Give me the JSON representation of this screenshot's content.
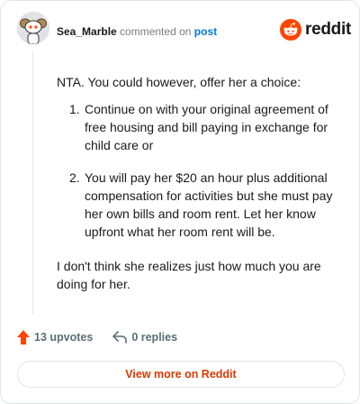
{
  "header": {
    "username": "Sea_Marble",
    "action_text": "commented on",
    "post_link": "post"
  },
  "brand": {
    "wordmark": "reddit",
    "color": "#ff4500"
  },
  "comment": {
    "intro": "NTA. You could however, offer her a choice:",
    "items": [
      {
        "number": "1.",
        "text": "Continue on with your original agreement of free housing and bill paying in exchange for child care or"
      },
      {
        "number": "2.",
        "text": "You will pay her $20 an hour plus additional compensation for activities but she must pay her own bills and room rent. Let her know upfront what her room rent will be."
      }
    ],
    "closing": "I don't think she realizes just how much you are doing for her."
  },
  "footer": {
    "upvotes": "13 upvotes",
    "replies": "0 replies",
    "upvote_color": "#ff4500"
  },
  "cta": {
    "label": "View more on Reddit",
    "color": "#d93a00"
  }
}
